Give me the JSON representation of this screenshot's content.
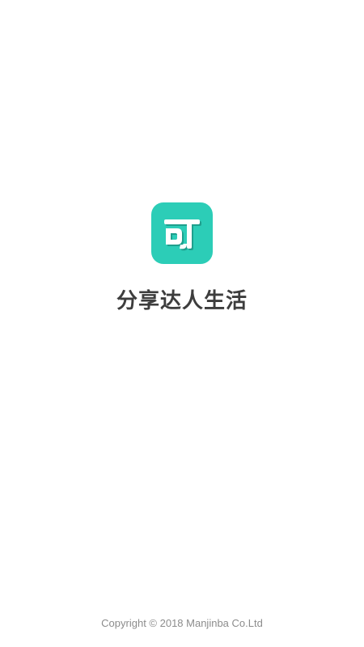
{
  "splash": {
    "logo": {
      "icon": "ke-glyph-logo-icon",
      "brand_color": "#2ccdb7",
      "glyph": "可"
    },
    "slogan": "分享达人生活",
    "copyright": "Copyright © 2018 Manjinba Co.Ltd"
  }
}
